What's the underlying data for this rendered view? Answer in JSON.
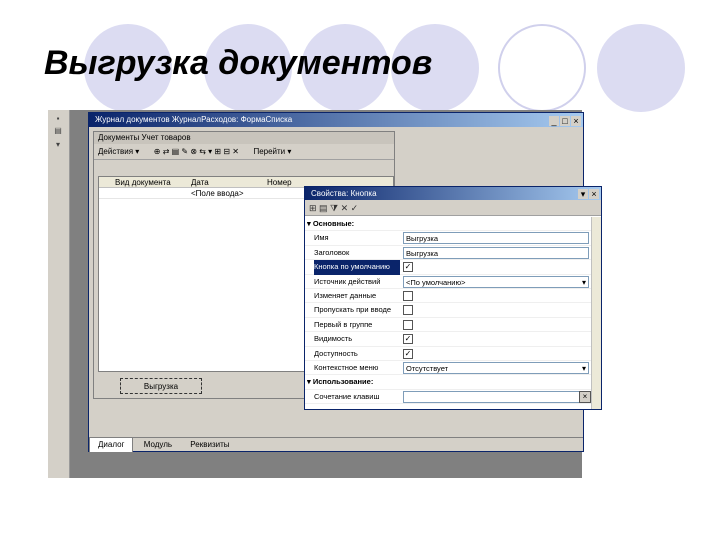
{
  "slide": {
    "title": "Выгрузка документов"
  },
  "ide": {
    "journal_window": {
      "title": "Журнал документов ЖурналРасходов: ФормаСписка",
      "controls": [
        "_",
        "□",
        "×"
      ]
    },
    "form": {
      "caption": "Документы Учет товаров",
      "toolbar": {
        "actions": "Действия ▾",
        "goto": "Перейти ▾"
      },
      "columns": [
        "Вид документа",
        "Дата",
        "Номер"
      ],
      "row_value": "<Поле ввода>",
      "export_button": "Выгрузка"
    },
    "tabs": [
      "Диалог",
      "Модуль",
      "Реквизиты"
    ]
  },
  "props": {
    "title": "Свойства: Кнопка",
    "controls": [
      "▾",
      "×"
    ],
    "toolbar": "⊞ ▤ ⧩   ✕  ✓",
    "rows": [
      {
        "label": "▾ Основные:",
        "type": "cat"
      },
      {
        "label": "Имя",
        "type": "text",
        "value": "Выгрузка"
      },
      {
        "label": "Заголовок",
        "type": "text",
        "value": "Выгрузка"
      },
      {
        "label": "Кнопка по умолчанию",
        "type": "check",
        "value": "✓",
        "selected": true
      },
      {
        "label": "Источник действий",
        "type": "dropdown",
        "value": "<По умолчанию>"
      },
      {
        "label": "Изменяет данные",
        "type": "check",
        "value": ""
      },
      {
        "label": "Пропускать при вводе",
        "type": "check",
        "value": ""
      },
      {
        "label": "Первый в группе",
        "type": "check",
        "value": ""
      },
      {
        "label": "Видимость",
        "type": "check",
        "value": "✓"
      },
      {
        "label": "Доступность",
        "type": "check",
        "value": "✓"
      },
      {
        "label": "Контекстное меню",
        "type": "dropdown",
        "value": "Отсутствует"
      },
      {
        "label": "▾ Использование:",
        "type": "cat"
      },
      {
        "label": "Сочетание клавиш",
        "type": "xtext",
        "value": ""
      }
    ]
  }
}
